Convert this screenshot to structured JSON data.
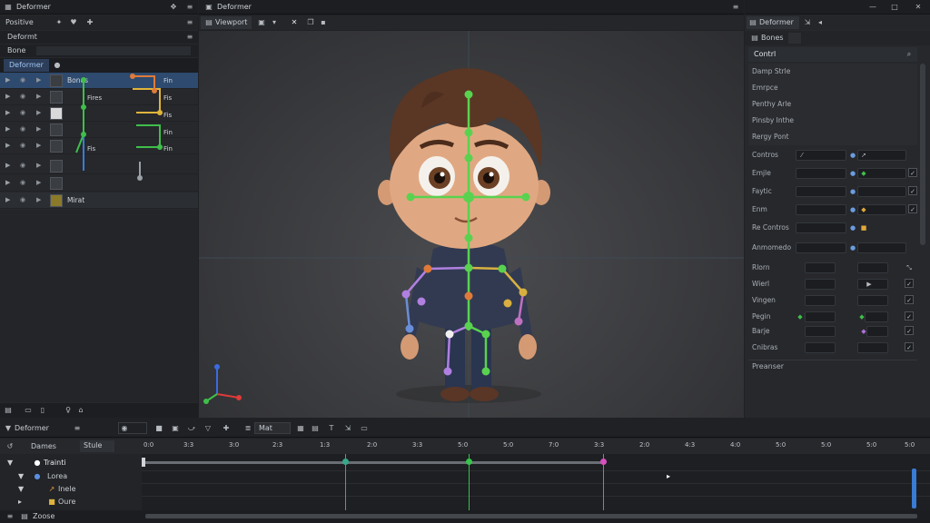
{
  "top": {
    "left_title": "Deformer",
    "center_title": "Deformer",
    "right_title": "Deformer"
  },
  "outliner": {
    "toolbar_label": "Positive",
    "tab1": "Deformt",
    "tab2": "Bone",
    "active": "Deformer",
    "items": [
      {
        "label": "Bones",
        "selected": true
      },
      {
        "label": ""
      },
      {
        "label": ""
      },
      {
        "label": ""
      },
      {
        "label": ""
      },
      {
        "label": ""
      },
      {
        "label": ""
      },
      {
        "label": "Mirat"
      }
    ],
    "rig_labels": [
      "Fin",
      "Fires",
      "Fis",
      "Fis",
      "Fin",
      "Fin",
      "Fis"
    ]
  },
  "viewport": {
    "tab": "Viewport"
  },
  "props": {
    "tab": "Deformer",
    "sub": "Bones",
    "section": "Contrl",
    "sliders": [
      "Damp Strle",
      "Emrpce",
      "Penthy Arle",
      "Pinsby Inthe",
      "Rergy Pont"
    ],
    "rows1": [
      "Contros",
      "Emjle",
      "Faytic",
      "Enm",
      "Re Contros"
    ],
    "group": "Anmomedo",
    "rows2": [
      "Rlorn",
      "Wierl",
      "Vingen",
      "Pegin",
      "Barje",
      "Cnibras"
    ],
    "footer": "Preanser"
  },
  "timeline": {
    "title": "Deformer",
    "toolbar_field": "Mat",
    "row_label": "Dames",
    "row_field": "Stule",
    "tracks": [
      "Trainti",
      "Lorea",
      "Inele",
      "Oure"
    ],
    "footer": "Zoose",
    "ticks": [
      "0:0",
      "3:3",
      "3:0",
      "2:3",
      "1:3",
      "2:0",
      "3:3",
      "5:0",
      "5:0",
      "7:0",
      "3:3",
      "2:0",
      "4:3",
      "4:0",
      "5:0",
      "5:0",
      "5:0",
      "5:0"
    ],
    "colors": {
      "green": "#37c44a",
      "pink": "#d84fc0",
      "teal": "#36a98a"
    }
  }
}
